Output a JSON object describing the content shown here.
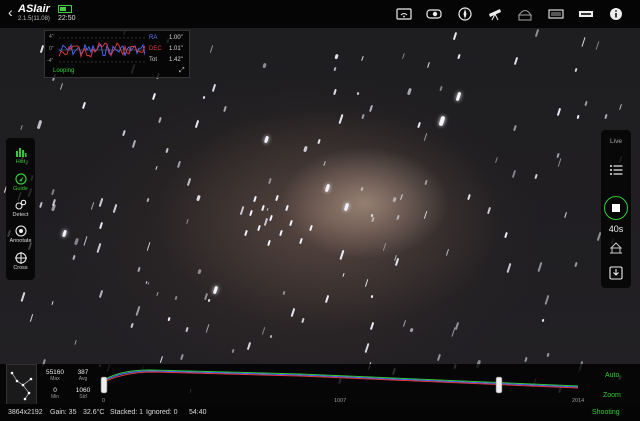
{
  "app": {
    "brand": "ASIair",
    "version": "2.1.5(11.08)",
    "clock": "22:50"
  },
  "top_icons": [
    "wifi-icon",
    "camera-icon",
    "focuser-icon",
    "telescope-icon",
    "observatory-icon",
    "filter-wheel-icon",
    "usb-icon",
    "info-icon"
  ],
  "guide": {
    "y_labels": [
      "4\"",
      "0\"",
      "-4\""
    ],
    "ra_label": "RA",
    "ra_value": "1.00\"",
    "dec_label": "DEC",
    "dec_value": "1.01\"",
    "tot_label": "Tot",
    "tot_value": "1.42\"",
    "state": "Looping",
    "ra_color": "#4a6cff",
    "dec_color": "#e23a3a"
  },
  "left_tools": [
    {
      "name": "hist",
      "label": "Hist",
      "active": true
    },
    {
      "name": "guide",
      "label": "Guide",
      "active": true
    },
    {
      "name": "detect",
      "label": "Detect",
      "active": false
    },
    {
      "name": "annotate",
      "label": "Annotate",
      "active": false
    },
    {
      "name": "cross",
      "label": "Cross",
      "active": false
    }
  ],
  "right_tools": {
    "live": "Live",
    "exposure": "40s"
  },
  "histogram": {
    "max_value": "55160",
    "max_label": "Max",
    "avg_value": "387",
    "avg_label": "Avg",
    "min_value": "0",
    "min_label": "Min",
    "std_value": "1060",
    "std_label": "Std",
    "axis_start": "0",
    "axis_mid": "1007",
    "axis_end": "2014",
    "auto_label": "Auto",
    "zoom_label": "Zoom"
  },
  "status": {
    "resolution": "3864x2192",
    "gain": "Gain: 35",
    "temp": "32.6°C",
    "stacked": "Stacked: 1",
    "ignored": "Ignored: 0",
    "elapsed": "54:40",
    "state": "Shooting"
  },
  "colors": {
    "accent": "#33cc33"
  }
}
